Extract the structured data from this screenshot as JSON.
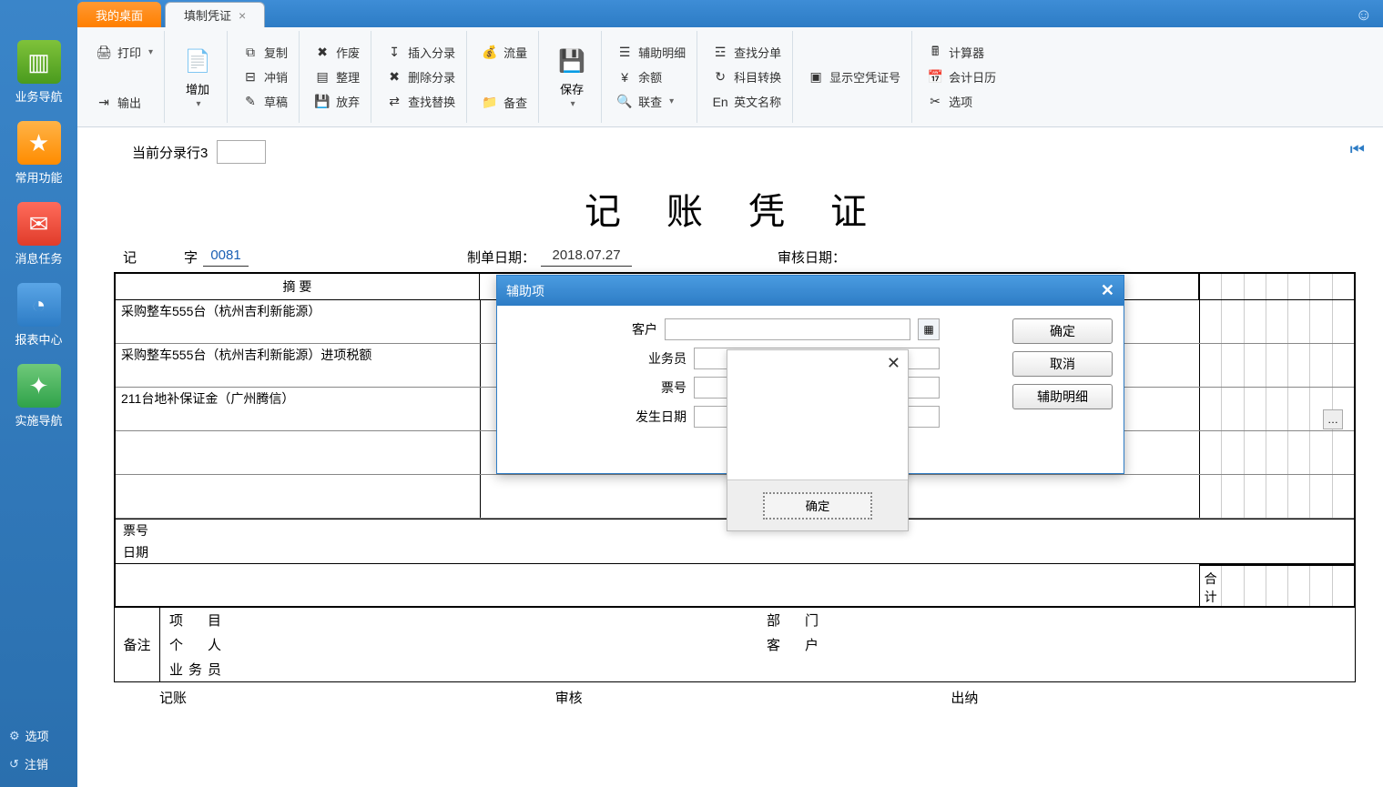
{
  "tabs": {
    "desktop": "我的桌面",
    "voucher": "填制凭证"
  },
  "sidebar": {
    "items": [
      "业务导航",
      "常用功能",
      "消息任务",
      "报表中心",
      "实施导航"
    ],
    "options": "选项",
    "logout": "注销"
  },
  "ribbon": {
    "print": "打印",
    "export": "输出",
    "add": "增加",
    "copy": "复制",
    "offset": "冲销",
    "draft": "草稿",
    "void": "作废",
    "arrange": "整理",
    "abandon": "放弃",
    "insert": "插入分录",
    "delrow": "删除分录",
    "findrep": "查找替换",
    "flow": "流量",
    "check": "备查",
    "save": "保存",
    "aux": "辅助明细",
    "balance": "余额",
    "drill": "联查",
    "findbill": "查找分单",
    "subconv": "科目转换",
    "enname": "英文名称",
    "showempty": "显示空凭证号",
    "calc": "计算器",
    "calendar": "会计日历",
    "opts": "选项"
  },
  "content": {
    "cur_row_label": "当前分录行3",
    "title": "记 账 凭 证",
    "ji": "记",
    "zi": "字",
    "num": "0081",
    "date_lab": "制单日期：",
    "date_val": "2018.07.27",
    "audit_lab": "审核日期：",
    "col_summary": "摘 要",
    "rows": [
      "采购整车555台（杭州吉利新能源）",
      "采购整车555台（杭州吉利新能源）进项税额",
      "211台地补保证金（广州腾信）",
      "",
      ""
    ],
    "foot_ticket": "票号",
    "foot_date": "日期",
    "total": "合 计",
    "remarks_lab": "备注",
    "rem_project": "项　目",
    "rem_dept": "部　门",
    "rem_person": "个　人",
    "rem_customer": "客　户",
    "rem_sales": "业务员",
    "sign_acc": "记账",
    "sign_audit": "审核",
    "sign_cash": "出纳"
  },
  "modal": {
    "title": "辅助项",
    "f_customer": "客户",
    "f_sales": "业务员",
    "f_ticket": "票号",
    "f_date": "发生日期",
    "ok": "确定",
    "cancel": "取消",
    "detail": "辅助明细"
  },
  "popup": {
    "ok": "确定"
  }
}
